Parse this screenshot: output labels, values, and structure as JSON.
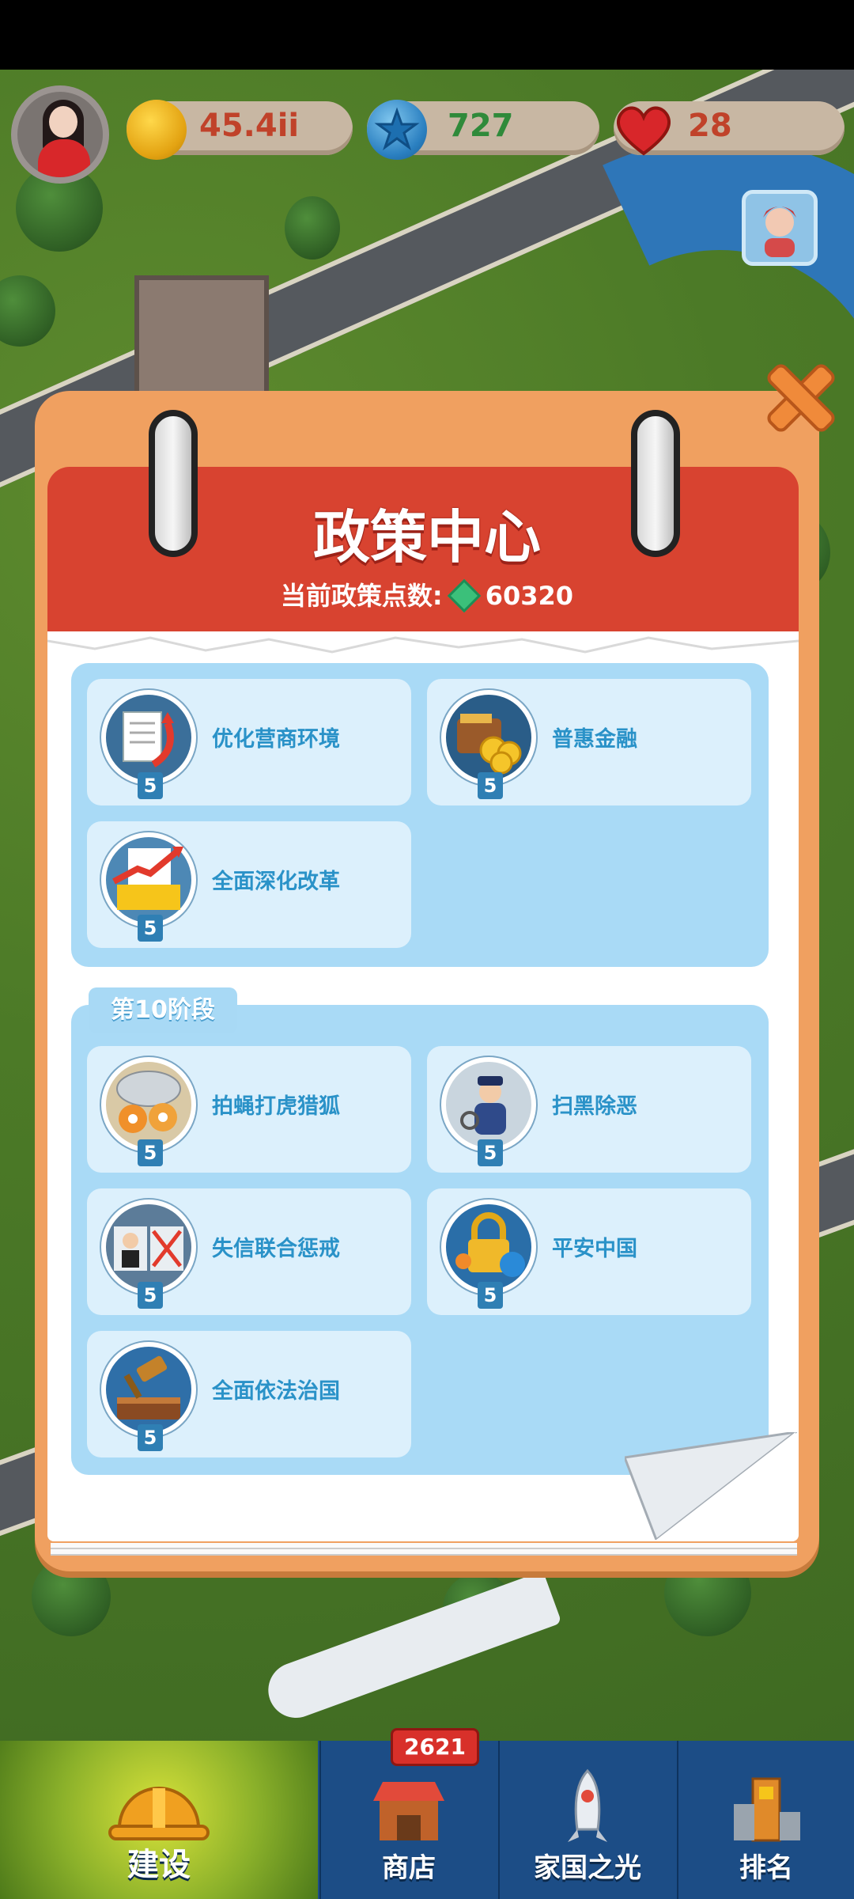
{
  "hud": {
    "coins": "45.4ii",
    "stars": "727",
    "hearts": "28"
  },
  "panel": {
    "title": "政策中心",
    "points_label": "当前政策点数:",
    "points_value": "60320"
  },
  "group1": {
    "cards": [
      {
        "label": "优化营商环境",
        "level": "5",
        "icon": "document-arrow-icon"
      },
      {
        "label": "普惠金融",
        "level": "5",
        "icon": "wallet-coins-icon"
      },
      {
        "label": "全面深化改革",
        "level": "5",
        "icon": "reform-chart-icon"
      }
    ]
  },
  "group2": {
    "stage": "第10阶段",
    "cards": [
      {
        "label": "拍蝇打虎猎狐",
        "level": "5",
        "icon": "tiger-fox-net-icon"
      },
      {
        "label": "扫黑除恶",
        "level": "5",
        "icon": "police-officer-icon"
      },
      {
        "label": "失信联合惩戒",
        "level": "5",
        "icon": "credit-penalty-icon"
      },
      {
        "label": "平安中国",
        "level": "5",
        "icon": "padlock-shield-icon"
      },
      {
        "label": "全面依法治国",
        "level": "5",
        "icon": "gavel-book-icon"
      }
    ]
  },
  "tabs": [
    {
      "label": "建设",
      "icon": "hard-hat-icon"
    },
    {
      "label": "商店",
      "icon": "shop-building-icon",
      "badge": "2621"
    },
    {
      "label": "家国之光",
      "icon": "rocket-icon"
    },
    {
      "label": "排名",
      "icon": "ranking-tower-icon"
    }
  ],
  "colors": {
    "accent_red": "#d84330",
    "panel_orange": "#f0a060",
    "card_blue": "#dcf0fc",
    "label_blue": "#2a92c8"
  }
}
